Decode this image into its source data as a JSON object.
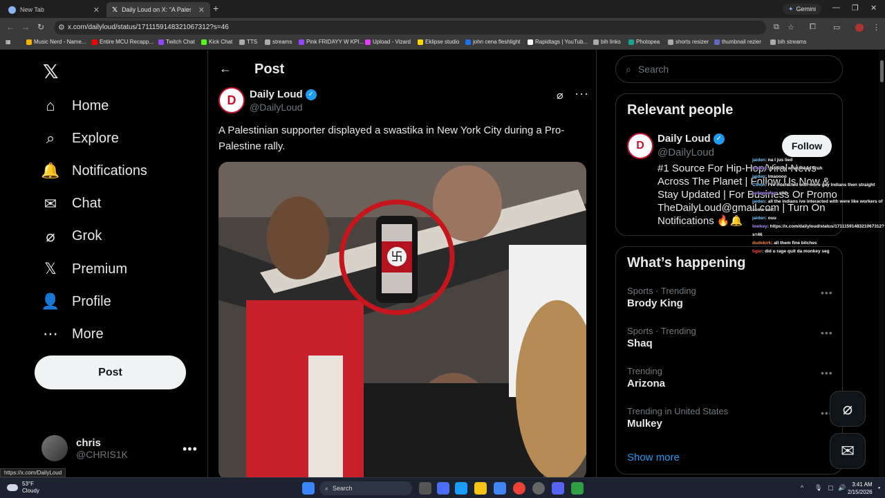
{
  "browser": {
    "tabs": [
      {
        "label": "New Tab"
      },
      {
        "label": "Daily Loud on X: \"A Palestinian"
      }
    ],
    "gemini_label": "Gemini",
    "url": "x.com/dailyloud/status/1711159148321067312?s=46",
    "bookmarks": [
      {
        "label": "Music Nerd - Name...",
        "color": "#f4b400"
      },
      {
        "label": "Entire MCU Recapp...",
        "color": "#ff0000"
      },
      {
        "label": "Twitch Chat",
        "color": "#9146ff"
      },
      {
        "label": "Kick Chat",
        "color": "#53fc18"
      },
      {
        "label": "TTS",
        "color": "#aaaaaa"
      },
      {
        "label": "streams",
        "color": "#aaaaaa"
      },
      {
        "label": "Pink FRIDAYY W KPI...",
        "color": "#9146ff"
      },
      {
        "label": "Upload - Vizard",
        "color": "#e040fb"
      },
      {
        "label": "Eklipse studio",
        "color": "#ffd600"
      },
      {
        "label": "john cena fleshlight",
        "color": "#1a73e8"
      },
      {
        "label": "Rapidtags | YouTub...",
        "color": "#ffffff"
      },
      {
        "label": "bih links",
        "color": "#aaaaaa"
      },
      {
        "label": "Photopea",
        "color": "#18a497"
      },
      {
        "label": "shorts resizer",
        "color": "#aaaaaa"
      },
      {
        "label": "thumbnail rezier",
        "color": "#5c6bc0"
      },
      {
        "label": "bih streams",
        "color": "#aaaaaa"
      }
    ]
  },
  "nav": {
    "items": [
      {
        "label": "Home",
        "icon": "home-icon"
      },
      {
        "label": "Explore",
        "icon": "search-icon"
      },
      {
        "label": "Notifications",
        "icon": "bell-icon"
      },
      {
        "label": "Chat",
        "icon": "mail-icon"
      },
      {
        "label": "Grok",
        "icon": "grok-icon"
      },
      {
        "label": "Premium",
        "icon": "x-icon"
      },
      {
        "label": "Profile",
        "icon": "person-icon"
      },
      {
        "label": "More",
        "icon": "more-circle-icon"
      }
    ],
    "post_label": "Post",
    "user": {
      "name": "chris",
      "handle": "@CHRIS1K"
    }
  },
  "post": {
    "header": "Post",
    "author_name": "Daily Loud",
    "author_handle": "@DailyLoud",
    "text": "A Palestinian supporter displayed a swastika in New York City during a Pro-Palestine rally."
  },
  "sidebar": {
    "search_placeholder": "Search",
    "relevant_title": "Relevant people",
    "person": {
      "name": "Daily Loud",
      "handle": "@DailyLoud",
      "follow_label": "Follow",
      "bio": "#1 Source For Hip-Hop/Viral News Across The Planet | Follow Us Now & Stay Updated | For Business Or Promo TheDailyLoud@gmail.com | Turn On Notifications 🔥🔔"
    },
    "happening_title": "What’s happening",
    "trends": [
      {
        "category": "Sports · Trending",
        "name": "Brody King"
      },
      {
        "category": "Sports · Trending",
        "name": "Shaq"
      },
      {
        "category": "Trending",
        "name": "Arizona"
      },
      {
        "category": "Trending in United States",
        "name": "Mulkey"
      }
    ],
    "show_more": "Show more"
  },
  "chat": [
    {
      "user": "jaiden",
      "msg": ": na I jus lied",
      "color": "#7ec8ff"
    },
    {
      "user": "lowkey",
      "msg": ": Nobody what mean bruh",
      "color": "#b48cff"
    },
    {
      "user": "jaiden",
      "msg": ": lmaoooo",
      "color": "#7ec8ff"
    },
    {
      "user": "Cthoh",
      "msg": ": I've interacted with more gay Indians then straight",
      "color": "#7ec8ff"
    },
    {
      "user": "sofaygofan",
      "msg": ": sikh",
      "color": "#b48cff"
    },
    {
      "user": "jaiden",
      "msg": ": all the indians ive interacted with were like workers of some sort",
      "color": "#7ec8ff"
    },
    {
      "user": "jaiden",
      "msg": ": ouu",
      "color": "#7ec8ff"
    },
    {
      "user": "lowkey",
      "msg": ": https://x.com/dailyloud/status/1711159148321067312?s=46",
      "color": "#b48cff"
    },
    {
      "user": "dudekirk",
      "msg": ": all them fine bitches",
      "color": "#ff8a3d"
    },
    {
      "user": "tiger",
      "msg": ": did u rage quit da monkey seg",
      "color": "#ff4d4d"
    }
  ],
  "status_link": "https://x.com/DailyLoud",
  "taskbar": {
    "weather_temp": "53°F",
    "weather_desc": "Cloudy",
    "search_label": "Search",
    "time": "3:41 AM",
    "date": "2/15/2026"
  }
}
